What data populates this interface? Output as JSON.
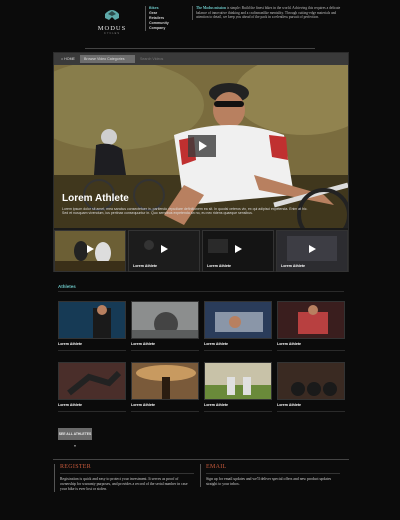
{
  "brand": {
    "name": "MODUS",
    "sub": "CYCLES",
    "icon": "helmet-logo-icon"
  },
  "nav": {
    "items": [
      "Bikes",
      "Gear",
      "Retailers",
      "Community",
      "Company"
    ]
  },
  "mission": {
    "lead": "The Modus mission",
    "text": " is simple: Build the finest bikes in the world. Achieving this requires a delicate balance of innovative thinking and a craftsmanlike mentality. Through cutting-edge materials and attention to detail, we keep you ahead of the pack in a relentless pursuit of perfection."
  },
  "video": {
    "tabs": {
      "home": "HOME",
      "categories": "Browse Video Categories",
      "search": "Search Videos"
    },
    "hero": {
      "title": "Lorem Athlete",
      "desc": "Lorem ipsum dolor sit amet, mea sanctus consectetuer in, partiendo repudiare definitionem ea sit. In quodsi ceteros vix, ex qui adipisci expetenda. Enim at hic. Sed et nusquam vivendum, ius pertinax consequuntur in. Quo sensibus expetenda an no, eu nec ridens quaeque sensibus."
    },
    "thumbs": [
      {
        "caption": ""
      },
      {
        "caption": "Lorem Athlete"
      },
      {
        "caption": "Lorem Athlete"
      },
      {
        "caption": "Lorem Athlete"
      }
    ]
  },
  "athletes": {
    "title": "Athletes",
    "items": [
      {
        "name": "Lorem Athlete"
      },
      {
        "name": "Lorem Athlete"
      },
      {
        "name": "Lorem Athlete"
      },
      {
        "name": "Lorem Athlete"
      },
      {
        "name": "Lorem Athlete"
      },
      {
        "name": "Lorem Athlete"
      },
      {
        "name": "Lorem Athlete"
      },
      {
        "name": "Lorem Athlete"
      }
    ],
    "all_button": "SEE ALL ATHLETES »"
  },
  "footer": {
    "register": {
      "title": "REGISTER",
      "text": "Registration is quick and easy to protect your investment. It serves as proof of ownership for warranty purposes, and provides a record of the serial number in case your bike is ever lost or stolen."
    },
    "email": {
      "title": "EMAIL",
      "text": "Sign up for email updates and we'll deliver special offers and new product updates straight to your inbox."
    }
  },
  "colors": {
    "accent": "#6cc6c6",
    "footer_title": "#c85a3c",
    "background": "#0b0b0b"
  }
}
